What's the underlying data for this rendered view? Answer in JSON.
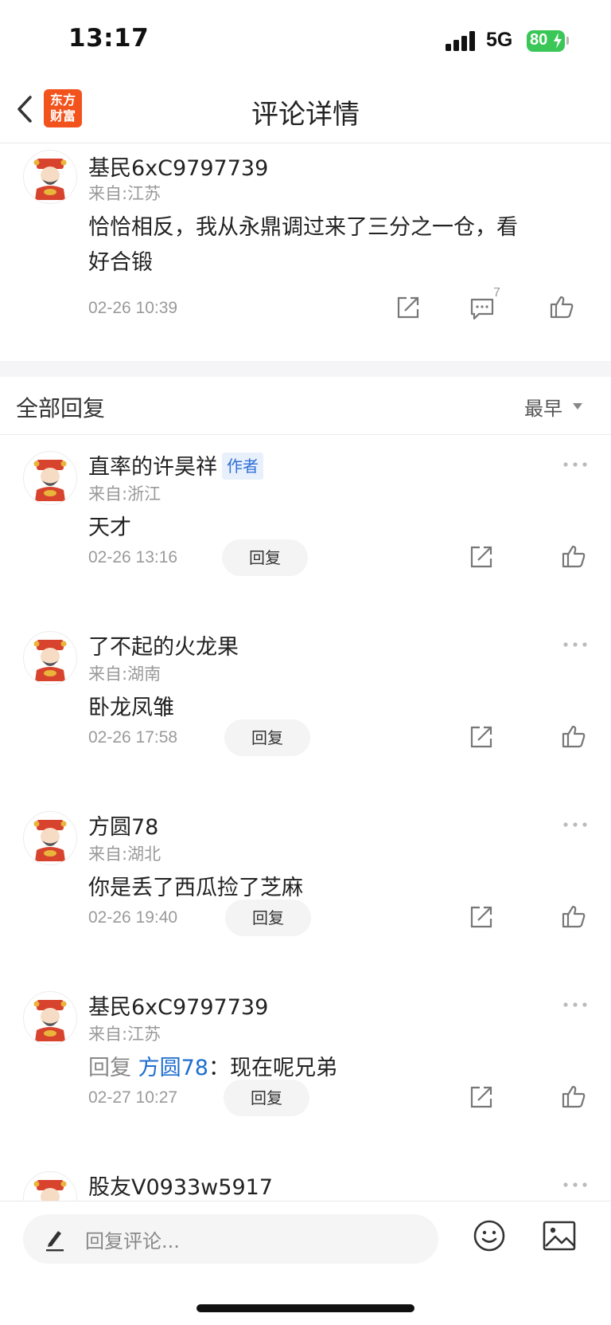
{
  "status_bar": {
    "time": "13:17",
    "network": "5G",
    "battery": "80",
    "battery_color": "#3ac758"
  },
  "nav": {
    "back_icon": "chevron-left-icon",
    "logo_line1": "东方",
    "logo_line2": "财富",
    "title": "评论详情",
    "logo_color": "#f2531d"
  },
  "main_comment": {
    "username": "基民6xC9797739",
    "location": "来自:江苏",
    "text_line1": "恰恰相反，我从永鼎调过来了三分之一仓，看",
    "text_line2": "好合锻",
    "time": "02-26 10:39",
    "comment_count": "7"
  },
  "replies_header": {
    "title": "全部回复",
    "sort": "最早"
  },
  "replies": [
    {
      "username": "直率的许昊祥",
      "badge": "作者",
      "location": "来自:浙江",
      "text": "天才",
      "time": "02-26 13:16",
      "reply_label": "回复"
    },
    {
      "username": "了不起的火龙果",
      "location": "来自:湖南",
      "text": "卧龙凤雏",
      "time": "02-26 17:58",
      "reply_label": "回复"
    },
    {
      "username": "方圆78",
      "location": "来自:湖北",
      "text": "你是丢了西瓜捡了芝麻",
      "time": "02-26 19:40",
      "reply_label": "回复"
    },
    {
      "username": "基民6xC9797739",
      "location": "来自:江苏",
      "reply_prefix": "回复",
      "reply_target": "方圆78",
      "reply_sep": "：",
      "text": "现在呢兄弟",
      "time": "02-27 10:27",
      "reply_label": "回复"
    },
    {
      "username": "股友V0933w5917"
    }
  ],
  "bottom_bar": {
    "placeholder": "回复评论...",
    "emoji_icon": "emoji-icon",
    "image_icon": "image-icon"
  }
}
